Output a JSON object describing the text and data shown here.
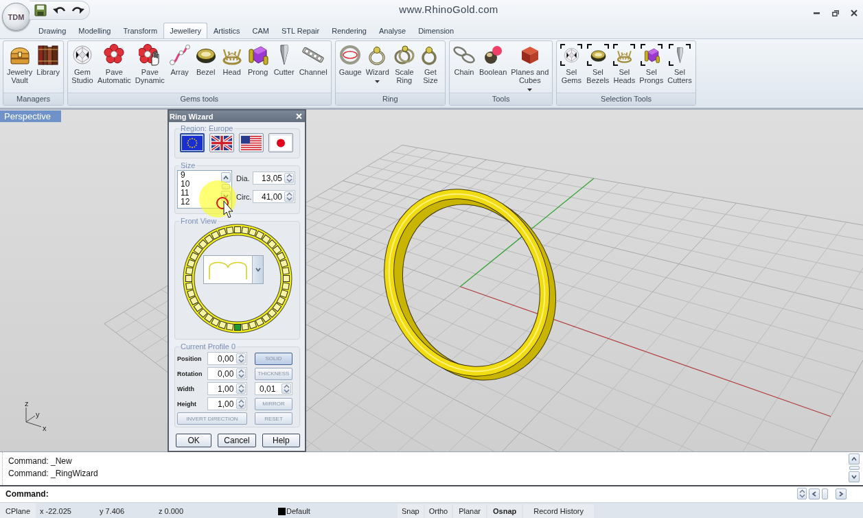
{
  "window": {
    "logo": "TDM",
    "title": "www.RhinoGold.com"
  },
  "tabs": [
    {
      "label": "Drawing",
      "selected": false
    },
    {
      "label": "Modelling",
      "selected": false
    },
    {
      "label": "Transform",
      "selected": false
    },
    {
      "label": "Jewellery",
      "selected": true
    },
    {
      "label": "Artistics",
      "selected": false
    },
    {
      "label": "CAM",
      "selected": false
    },
    {
      "label": "STL Repair",
      "selected": false
    },
    {
      "label": "Rendering",
      "selected": false
    },
    {
      "label": "Analyse",
      "selected": false
    },
    {
      "label": "Dimension",
      "selected": false
    }
  ],
  "ribbon_groups": [
    {
      "label": "Managers",
      "tools": [
        {
          "label": "Jewelry\nVault",
          "menu": false
        },
        {
          "label": "Library",
          "menu": false
        }
      ]
    },
    {
      "label": "Gems tools",
      "tools": [
        {
          "label": "Gem\nStudio",
          "menu": false
        },
        {
          "label": "Pave\nAutomatic",
          "menu": false
        },
        {
          "label": "Pave\nDynamic",
          "menu": false
        },
        {
          "label": "Array",
          "menu": false
        },
        {
          "label": "Bezel",
          "menu": false
        },
        {
          "label": "Head",
          "menu": false
        },
        {
          "label": "Prong",
          "menu": false
        },
        {
          "label": "Cutter",
          "menu": false
        },
        {
          "label": "Channel",
          "menu": false
        }
      ]
    },
    {
      "label": "Ring",
      "tools": [
        {
          "label": "Gauge",
          "menu": false
        },
        {
          "label": "Wizard",
          "menu": true
        },
        {
          "label": "Scale\nRing",
          "menu": false
        },
        {
          "label": "Get\nSize",
          "menu": false
        }
      ]
    },
    {
      "label": "Tools",
      "tools": [
        {
          "label": "Chain",
          "menu": false
        },
        {
          "label": "Boolean",
          "menu": false
        },
        {
          "label": "Planes and\nCubes",
          "menu": true
        }
      ]
    },
    {
      "label": "Selection Tools",
      "tools": [
        {
          "label": "Sel\nGems",
          "menu": false
        },
        {
          "label": "Sel\nBezels",
          "menu": false
        },
        {
          "label": "Sel\nHeads",
          "menu": false
        },
        {
          "label": "Sel\nProngs",
          "menu": false
        },
        {
          "label": "Sel\nCutters",
          "menu": false
        }
      ]
    }
  ],
  "viewport": {
    "label": "Perspective",
    "axis_labels": [
      "z",
      "y",
      "x"
    ]
  },
  "ring_wizard": {
    "title": "Ring Wizard",
    "region": {
      "label": "Region: Europe",
      "flags": [
        {
          "selected": true
        },
        {
          "selected": false
        },
        {
          "selected": false
        },
        {
          "selected": false
        }
      ]
    },
    "size": {
      "label": "Size",
      "sizes": [
        "9",
        "10",
        "11",
        "12"
      ],
      "fields": [
        {
          "label": "Dia.",
          "value": "13,05"
        },
        {
          "label": "Circ.",
          "value": "41,00"
        }
      ]
    },
    "front_view": {
      "label": "Front View"
    },
    "profile": {
      "label": "Current Profile 0",
      "fields": [
        {
          "label": "Position",
          "value": "0,00"
        },
        {
          "label": "Rotation",
          "value": "0,00"
        },
        {
          "label": "Width",
          "value": "1,00"
        },
        {
          "label": "Height",
          "value": "1,00"
        }
      ],
      "side": [
        {
          "kind": "toggle",
          "label": "SOLID",
          "selected": true
        },
        {
          "kind": "toggle",
          "label": "THICKNESS",
          "selected": false
        },
        {
          "kind": "field",
          "value": "0,01"
        },
        {
          "kind": "toggle",
          "label": "MIRROR",
          "selected": false
        }
      ],
      "actions": [
        "INVERT DIRECTION",
        "RESET"
      ]
    },
    "buttons": [
      "OK",
      "Cancel",
      "Help"
    ]
  },
  "command": {
    "history": [
      "Command: _New",
      "Command: _RingWizard"
    ],
    "prompt": "Command:"
  },
  "status_bar": {
    "cplane": "CPlane",
    "coordinates": [
      "x -22.025",
      "y 7.406",
      "z 0.000"
    ],
    "layer": "Default",
    "toggles": [
      {
        "label": "Snap",
        "on": false
      },
      {
        "label": "Ortho",
        "on": false
      },
      {
        "label": "Planar",
        "on": false
      },
      {
        "label": "Osnap",
        "on": true
      },
      {
        "label": "Record History",
        "on": false
      }
    ]
  }
}
